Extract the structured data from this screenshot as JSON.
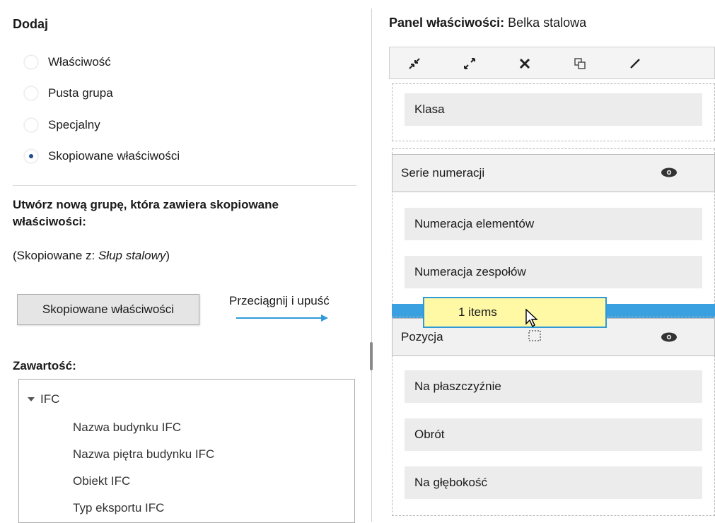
{
  "left": {
    "add_title": "Dodaj",
    "radio_options": [
      {
        "label": "Właściwość",
        "selected": false
      },
      {
        "label": "Pusta grupa",
        "selected": false
      },
      {
        "label": "Specjalny",
        "selected": false
      },
      {
        "label": "Skopiowane właściwości",
        "selected": true
      }
    ],
    "description": "Utwórz nową grupę, która zawiera skopiowane właściwości:",
    "copied_from_prefix": "(Skopiowane z: ",
    "copied_from_name": "Słup stalowy",
    "copied_from_suffix": ")",
    "copy_button": "Skopiowane właściwości",
    "drag_hint": "Przeciągnij i upuść",
    "contents_title": "Zawartość:",
    "tree": {
      "root": "IFC",
      "children": [
        "Nazwa budynku IFC",
        "Nazwa piętra budynku IFC",
        "Obiekt IFC",
        "Typ eksportu IFC"
      ]
    }
  },
  "right": {
    "panel_title_bold": "Panel właściwości:",
    "panel_title_value": "Belka stalowa",
    "toolbar_icons": [
      "collapse-icon",
      "expand-icon",
      "delete-icon",
      "copy-icon",
      "edit-icon"
    ],
    "fields_top": [
      "Klasa"
    ],
    "group1": {
      "title": "Serie numeracji",
      "fields": [
        "Numeracja elementów",
        "Numeracja zespołów"
      ]
    },
    "drag_tooltip": "1 items",
    "group2": {
      "title": "Pozycja",
      "fields": [
        "Na płaszczyźnie",
        "Obrót",
        "Na głębokość"
      ]
    }
  },
  "colors": {
    "accent": "#3aa0e0",
    "tooltip_bg": "#fff9a6"
  }
}
